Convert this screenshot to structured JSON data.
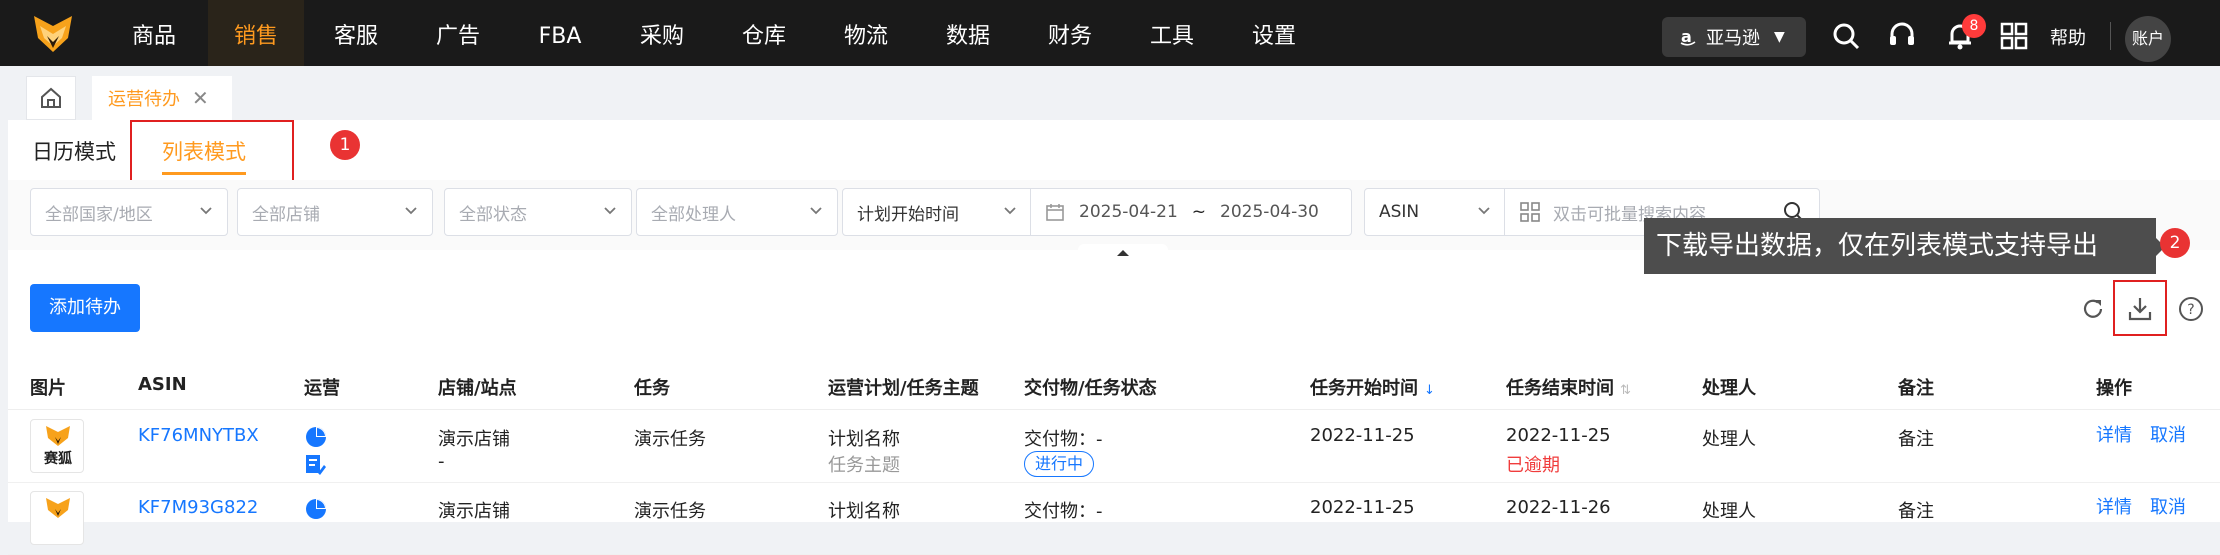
{
  "nav": {
    "items": [
      "商品",
      "销售",
      "客服",
      "广告",
      "FBA",
      "采购",
      "仓库",
      "物流",
      "数据",
      "财务",
      "工具",
      "设置"
    ],
    "active": "销售",
    "region_label": "亚马逊",
    "notification_count": "8",
    "help_label": "帮助",
    "account_label": "账户"
  },
  "page_tab": {
    "label": "运营待办",
    "close": "✕"
  },
  "mode_tabs": {
    "calendar": "日历模式",
    "list": "列表模式"
  },
  "annotations": {
    "badge_1": "1",
    "badge_2": "2",
    "tooltip": "下载导出数据，仅在列表模式支持导出"
  },
  "filters": {
    "country_placeholder": "全部国家/地区",
    "store_placeholder": "全部店铺",
    "status_placeholder": "全部状态",
    "handler_placeholder": "全部处理人",
    "time_type": "计划开始时间",
    "date_start": "2025-04-21",
    "date_sep": "~",
    "date_end": "2025-04-30",
    "search_field": "ASIN",
    "search_placeholder": "双击可批量搜索内容"
  },
  "toolbar": {
    "add_label": "添加待办"
  },
  "table": {
    "headers": {
      "image": "图片",
      "asin": "ASIN",
      "ops": "运营",
      "store": "店铺/站点",
      "task": "任务",
      "plan": "运营计划/任务主题",
      "deliverable": "交付物/任务状态",
      "start": "任务开始时间",
      "end": "任务结束时间",
      "handler": "处理人",
      "note": "备注",
      "actions": "操作"
    },
    "rows": [
      {
        "thumb_text": "赛狐",
        "asin": "KF76MNYTBX",
        "store": "演示店铺",
        "store_sub": "-",
        "task": "演示任务",
        "plan": "计划名称",
        "plan_sub": "任务主题",
        "deliverable": "交付物：-",
        "status": "进行中",
        "start": "2022-11-25",
        "end": "2022-11-25",
        "end_sub": "已逾期",
        "handler": "处理人",
        "note": "备注",
        "detail": "详情",
        "cancel": "取消"
      },
      {
        "thumb_text": "",
        "asin": "KF7M93G822",
        "store": "演示店铺",
        "store_sub": "",
        "task": "演示任务",
        "plan": "计划名称",
        "plan_sub": "",
        "deliverable": "交付物：-",
        "status": "",
        "start": "2022-11-25",
        "end": "2022-11-26",
        "end_sub": "",
        "handler": "处理人",
        "note": "备注",
        "detail": "详情",
        "cancel": "取消"
      }
    ]
  },
  "colors": {
    "accent": "#ff9a1f",
    "primary": "#1677ff",
    "danger": "#e02020",
    "nav_bg": "#1a1a1a"
  }
}
